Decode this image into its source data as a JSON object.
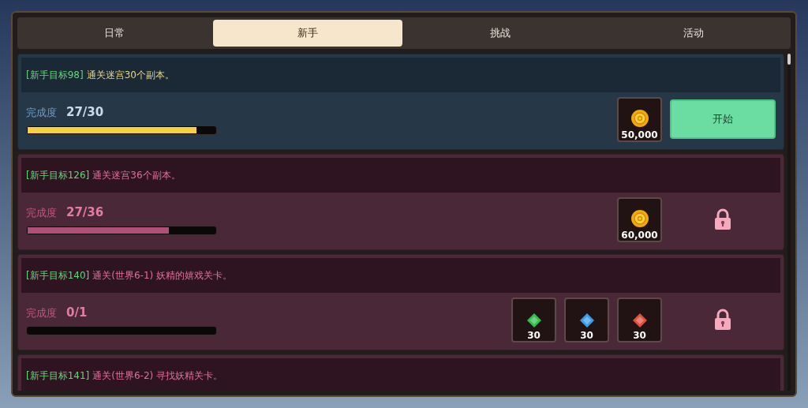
{
  "tabs": [
    {
      "label": "日常",
      "selected": false
    },
    {
      "label": "新手",
      "selected": true
    },
    {
      "label": "挑战",
      "selected": false
    },
    {
      "label": "活动",
      "selected": false
    }
  ],
  "quests": [
    {
      "locked": false,
      "tag": "[新手目标98]",
      "text": "通关迷宫30个副本。",
      "progress_label": "完成度",
      "progress": "27/30",
      "level": 0.9,
      "rewards": [
        {
          "kind": "coin",
          "amount": "50,000"
        }
      ],
      "action": {
        "kind": "button",
        "label": "开始"
      }
    },
    {
      "locked": true,
      "tag": "[新手目标126]",
      "text": "通关迷宫36个副本。",
      "progress_label": "完成度",
      "progress": "27/36",
      "level": 0.75,
      "rewards": [
        {
          "kind": "coin",
          "amount": "60,000"
        }
      ],
      "action": {
        "kind": "lock"
      }
    },
    {
      "locked": true,
      "tag": "[新手目标140]",
      "text": "通关(世界6-1) 妖精的嬉戏关卡。",
      "progress_label": "完成度",
      "progress": "0/1",
      "level": 0,
      "rewards": [
        {
          "kind": "gem",
          "color": "#2fbf4a",
          "amount": "30"
        },
        {
          "kind": "gem",
          "color": "#3a9ee8",
          "amount": "30"
        },
        {
          "kind": "gem",
          "color": "#e0503a",
          "amount": "30"
        }
      ],
      "action": {
        "kind": "lock"
      }
    },
    {
      "locked": true,
      "tag": "[新手目标141]",
      "text": "通关(世界6-2) 寻找妖精关卡。"
    }
  ]
}
